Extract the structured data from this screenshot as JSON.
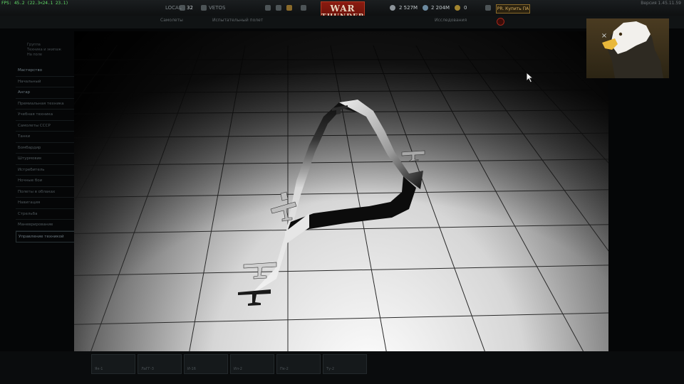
{
  "hud": {
    "fps": "FPS: 45.2 (22.3<24.1 23.1)",
    "version": "Версия 1.45.11.59",
    "level_label": "LOCAL",
    "rank": "32",
    "rank_label": "VETOS",
    "silver_lions": "2 527М",
    "research_points": "2 204М",
    "golden_eagles": "0",
    "premium_label": "PR. Купить ПА",
    "logo_line1": "WAR",
    "logo_line2": "THUNDER"
  },
  "subbar": {
    "tabs": [
      "Самолеты",
      "Испытательный полет",
      "Исследования"
    ]
  },
  "left_panel": {
    "notes": [
      "Группа",
      "Техника и экипаж",
      "На поле"
    ],
    "items": [
      "Мастерство",
      "Начальный",
      "Ангар",
      "Премиальная техника",
      "Учебная техника",
      "Самолеты СССР",
      "Танки",
      "Бомбардир",
      "Штурмовик",
      "Истребитель",
      "Ночные бои",
      "Полеты в облаках",
      "Навигация",
      "Стрельба",
      "Маневрирование",
      "Управление техникой"
    ]
  },
  "bottom": {
    "cards": [
      "Як-1",
      "ЛаГГ-3",
      "И-16",
      "Ил-2",
      "Пе-2",
      "Ту-2"
    ]
  },
  "dialog": {
    "close_glyph": "×"
  },
  "icons": {
    "close": "close-icon",
    "cursor": "mouse-pointer-icon",
    "eagle": "eagle-portrait-icon",
    "aircraft": "aircraft-icon"
  },
  "colors": {
    "logo_red": "#8a1b10",
    "fps_green": "#63e06a",
    "premium_gold": "#d8b060"
  }
}
